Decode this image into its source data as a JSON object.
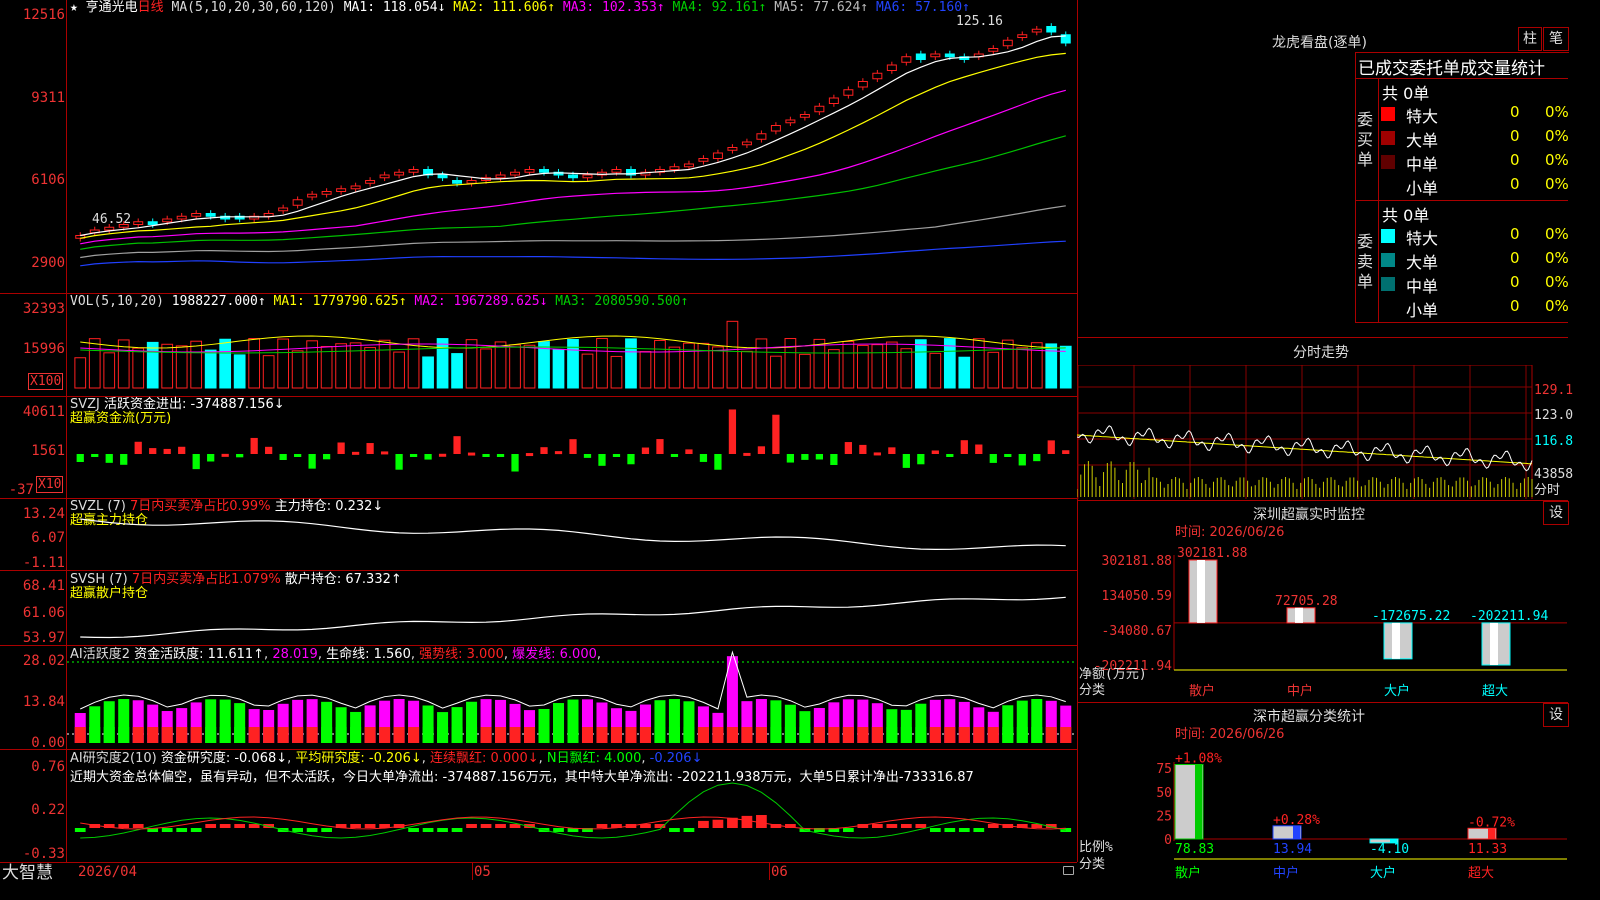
{
  "main": {
    "stock_name": "亨通光电",
    "period": "日线",
    "star": "★",
    "ma_label": "MA(5,10,20,30,60,120)",
    "ma1": "MA1: 118.054↓",
    "ma2": "MA2: 111.606↑",
    "ma3": "MA3: 102.353↑",
    "ma4": "MA4: 92.161↑",
    "ma5": "MA5: 77.624↑",
    "ma6": "MA6: 57.160↑",
    "y_ticks": [
      "12516",
      "9311",
      "6106",
      "2900"
    ],
    "high_label": "125.16",
    "low_label": "46.52",
    "colors": {
      "ma1": "#ffffff",
      "ma2": "#ffff00",
      "ma3": "#ff00ff",
      "ma4": "#00c000",
      "ma5": "#a0a0a0",
      "ma6": "#2040ff",
      "up": "#ff2020",
      "down": "#00ffff"
    }
  },
  "vol": {
    "label": "VOL(5,10,20)",
    "value": "1988227.000↑",
    "ma1": "MA1: 1779790.625↑",
    "ma2": "MA2: 1967289.625↓",
    "ma3": "MA3: 2080590.500↑",
    "y_ticks": [
      "32393",
      "15996"
    ],
    "unit": "X100"
  },
  "svzj": {
    "label": "SVZJ",
    "title": "活跃资金进出: -374887.156↓",
    "subtitle": "超赢资金流(万元)",
    "y_ticks": [
      "40611",
      "1561",
      "-37"
    ],
    "unit": "X10"
  },
  "svzl": {
    "label": "SVZL (7)",
    "ratio": "7日内买卖净占比0.99%",
    "hold": "主力持仓: 0.232↓",
    "subtitle": "超赢主力持仓",
    "y_ticks": [
      "13.24",
      "6.07",
      "-1.11"
    ]
  },
  "svsh": {
    "label": "SVSH (7)",
    "ratio": "7日内买卖净占比1.079%",
    "hold": "散户持仓: 67.332↑",
    "subtitle": "超赢散户持仓",
    "y_ticks": [
      "68.41",
      "61.06",
      "53.97"
    ]
  },
  "ai_active": {
    "label": "AI活跃度2",
    "fund": "资金活跃度: 11.611↑",
    "v2": "28.019",
    "life": "生命线: 1.560",
    "strong": "强势线: 3.000",
    "burst": "爆发线: 6.000",
    "y_ticks": [
      "28.02",
      "13.84",
      "0.00"
    ]
  },
  "ai_research": {
    "label": "AI研究度2(10)",
    "research": "资金研究度: -0.068↓",
    "avg": "平均研究度: -0.206↓",
    "red": "连续飘红: 0.000↓",
    "nred": "N日飘红: 4.000",
    "v5": "-0.206↓",
    "text": "近期大资金总体偏空，虽有异动，但不太活跃，今日大单净流出: -374887.156万元，其中特大单净流出: -202211.938万元，大单5日累计净出-733316.87",
    "y_ticks": [
      "0.76",
      "0.22",
      "-0.33"
    ]
  },
  "x_axis": {
    "brand": "大智慧",
    "date": "2026/04",
    "labels": [
      "05",
      "06"
    ]
  },
  "dragon": {
    "title": "龙虎看盘(逐单)",
    "btn_bar": "柱",
    "btn_pen": "笔",
    "tabs": "已成交委托单成交量统计",
    "buy_label": "委买单",
    "sell_label": "委卖单",
    "buy_total": "共 0单",
    "sell_total": "共 0单",
    "buy_rows": [
      {
        "name": "特大",
        "count": "0",
        "pct": "0%",
        "color": "#ff0000"
      },
      {
        "name": "大单",
        "count": "0",
        "pct": "0%",
        "color": "#a00000"
      },
      {
        "name": "中单",
        "count": "0",
        "pct": "0%",
        "color": "#600000"
      },
      {
        "name": "小单",
        "count": "0",
        "pct": "0%",
        "color": ""
      }
    ],
    "sell_rows": [
      {
        "name": "特大",
        "count": "0",
        "pct": "0%",
        "color": "#00ffff"
      },
      {
        "name": "大单",
        "count": "0",
        "pct": "0%",
        "color": "#008888"
      },
      {
        "name": "中单",
        "count": "0",
        "pct": "0%",
        "color": "#007070"
      },
      {
        "name": "小单",
        "count": "0",
        "pct": "0%",
        "color": ""
      }
    ]
  },
  "intraday": {
    "title": "分时走势",
    "y_ticks": [
      "129.1",
      "123.0",
      "116.8",
      "43858"
    ],
    "x_label": "分时"
  },
  "monitor": {
    "title": "深圳超赢实时监控",
    "setting": "设",
    "time": "时间: 2026/06/26",
    "y_ticks": [
      "302181.88",
      "134050.59",
      "-34080.67",
      "-202211.94"
    ],
    "y_unit": "净额(万元)",
    "x_unit": "分类",
    "categories": [
      "散户",
      "中户",
      "大户",
      "超大"
    ],
    "values": [
      302181.88,
      72705.28,
      -172675.22,
      -202211.94
    ],
    "value_labels": [
      "302181.88",
      "72705.28",
      "-172675.22",
      "-202211.94"
    ]
  },
  "classify": {
    "title": "深市超赢分类统计",
    "setting": "设",
    "time": "时间: 2026/06/26",
    "y_ticks": [
      "75",
      "50",
      "25",
      "0"
    ],
    "y_unit": "比例%",
    "x_unit": "分类",
    "categories": [
      "散户",
      "中户",
      "大户",
      "超大"
    ],
    "values": [
      78.83,
      13.94,
      -4.1,
      11.33
    ],
    "value_labels": [
      "78.83",
      "13.94",
      "-4.10",
      "11.33"
    ],
    "change_labels": [
      "+1.08%",
      "+0.28%",
      "",
      "-0.72%"
    ]
  },
  "chart_data": {
    "type": "candlestick",
    "title": "亨通光电 日线",
    "x_labels": [
      "2026/04",
      "05",
      "06"
    ],
    "price_high": 125.16,
    "price_low": 46.52,
    "series": [
      {
        "name": "MA1",
        "last": 118.054
      },
      {
        "name": "MA2",
        "last": 111.606
      },
      {
        "name": "MA3",
        "last": 102.353
      },
      {
        "name": "MA4",
        "last": 92.161
      },
      {
        "name": "MA5",
        "last": 77.624
      },
      {
        "name": "MA6",
        "last": 57.16
      }
    ],
    "close": [
      48,
      50,
      51,
      52,
      53,
      52,
      54,
      55,
      56,
      55,
      54,
      54,
      55,
      56,
      58,
      61,
      63,
      64,
      65,
      66,
      68,
      70,
      71,
      72,
      70,
      69,
      67,
      68,
      69,
      70,
      71,
      72,
      71,
      70,
      69,
      70,
      71,
      72,
      70,
      71,
      72,
      73,
      74,
      76,
      78,
      80,
      82,
      85,
      88,
      90,
      92,
      95,
      98,
      101,
      104,
      107,
      110,
      113,
      112,
      114,
      113,
      112,
      114,
      116,
      119,
      121,
      123,
      122,
      118
    ],
    "open": [
      47,
      49,
      50,
      51,
      52,
      53,
      53,
      54,
      55,
      56,
      55,
      55,
      54,
      55,
      57,
      59,
      62,
      63,
      64,
      65,
      67,
      69,
      70,
      71,
      72,
      70,
      68,
      67,
      68,
      69,
      70,
      71,
      72,
      71,
      70,
      69,
      70,
      71,
      72,
      70,
      71,
      72,
      73,
      75,
      76,
      79,
      81,
      83,
      86,
      89,
      91,
      93,
      96,
      99,
      102,
      105,
      108,
      111,
      114,
      113,
      114,
      113,
      113,
      115,
      117,
      120,
      122,
      124,
      121
    ]
  }
}
